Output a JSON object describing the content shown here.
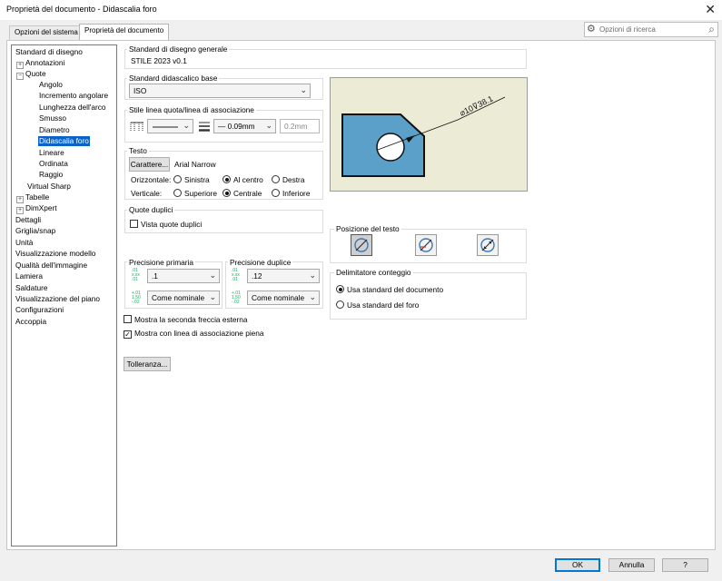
{
  "window": {
    "title": "Proprietà del documento - Didascalia foro"
  },
  "tabs": [
    {
      "label": "Opzioni del sistema",
      "active": false
    },
    {
      "label": "Proprietà del documento",
      "active": true
    }
  ],
  "search": {
    "placeholder": "Opzioni di ricerca"
  },
  "tree": {
    "items": [
      "Standard di disegno",
      "Annotazioni",
      "Quote",
      "Angolo",
      "Incremento angolare",
      "Lunghezza dell'arco",
      "Smusso",
      "Diametro",
      "Didascalia foro",
      "Lineare",
      "Ordinata",
      "Raggio",
      "Virtual Sharp",
      "Tabelle",
      "DimXpert",
      "Dettagli",
      "Griglia/snap",
      "Unità",
      "Visualizzazione modello",
      "Qualità dell'immagine",
      "Lamiera",
      "Saldature",
      "Visualizzazione del piano",
      "Configurazioni",
      "Accoppia"
    ],
    "expanders": {
      "annotazioni": "+",
      "quote": "−",
      "tabelle": "+",
      "dimxpert": "+"
    }
  },
  "general": {
    "label": "Standard di disegno generale",
    "value": "STILE 2023 v0.1"
  },
  "base": {
    "label": "Standard didascalico base",
    "value": "ISO"
  },
  "linestyle": {
    "label": "Stile linea quota/linea di associazione",
    "thickness": "0.09mm",
    "custom": "0.2mm"
  },
  "text": {
    "label": "Testo",
    "font_button": "Carattere...",
    "font_name": "Arial Narrow",
    "horizontal_label": "Orizzontale:",
    "vertical_label": "Verticale:",
    "h_options": [
      "Sinistra",
      "Al centro",
      "Destra"
    ],
    "h_selected": "Al centro",
    "v_options": [
      "Superiore",
      "Centrale",
      "Inferiore"
    ],
    "v_selected": "Centrale"
  },
  "dual": {
    "label": "Quote duplici",
    "checkbox": "Vista quote duplici",
    "checked": false
  },
  "precision": {
    "primary_label": "Precisione primaria",
    "primary_value": ".1",
    "primary_tol": "Come nominale",
    "dual_label": "Precisione duplice",
    "dual_value": ".12",
    "dual_tol": "Come nominale"
  },
  "options": {
    "second_arrow": "Mostra la seconda freccia esterna",
    "second_arrow_checked": false,
    "solid_leader": "Mostra con linea di associazione piena",
    "solid_leader_checked": true
  },
  "tolerance_button": "Tolleranza...",
  "preview": {
    "dimension_text": "⌀10⊽38.1",
    "fill_color": "#5aa0c8"
  },
  "text_position": {
    "label": "Posizione del testo",
    "selected_index": 0
  },
  "count_delimiter": {
    "label": "Delimitatore conteggio",
    "options": [
      "Usa standard del documento",
      "Usa standard del foro"
    ],
    "selected": "Usa standard del documento"
  },
  "footer": {
    "ok": "OK",
    "cancel": "Annulla",
    "help": "?"
  }
}
